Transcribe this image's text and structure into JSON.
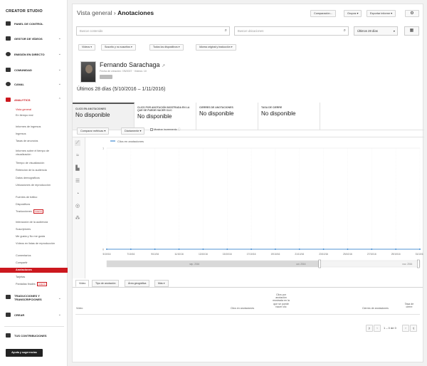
{
  "sidebar": {
    "title": "CREATOR STUDIO",
    "sections": {
      "panel": "PANEL DE CONTROL",
      "videos": "GESTOR DE VÍDEOS",
      "live": "EMISIÓN EN DIRECTO",
      "community": "COMUNIDAD",
      "channel": "CANAL",
      "analytics": "ANALYTICS",
      "translations": "TRADUCCIONES Y TRANSCRIPCIONES",
      "create": "CREAR",
      "contributions": "TUS CONTRIBUCIONES"
    },
    "items": {
      "overview": "Vista general",
      "realtime": "En tiempo real",
      "revenue_reports": "Informes de ingresos",
      "revenue": "Ingresos",
      "ad_rates": "Tasas de anuncios",
      "watch_time_reports": "Informes sobre el tiempo de visualización",
      "watch_time": "Tiempo de visualización",
      "retention": "Retención de la audiencia",
      "demographics": "Datos demográficos",
      "playback_locations": "Ubicaciones de reproducción",
      "traffic_sources": "Fuentes de tráfico",
      "devices": "Dispositivos",
      "translations_item": "Traducciones",
      "engagement_reports": "Interacción de la audiencia",
      "subscribers": "Suscriptores",
      "likes": "Me gusta y No me gusta",
      "playlists": "Vídeos en listas de reproducción",
      "comments": "Comentarios",
      "shares": "Compartir",
      "annotations": "Anotaciones",
      "cards": "Tarjetas",
      "end_screens": "Pantallas finales"
    },
    "badge_new": "NUEVO",
    "help_button": "Ayuda y sugerencias"
  },
  "header": {
    "breadcrumb_parent": "Vista general",
    "separator": "›",
    "title": "Anotaciones",
    "compare_button": "Comparación...",
    "groups_button": "Grupos",
    "export_button": "Exportar informe",
    "settings_icon": "gear-icon"
  },
  "filters": {
    "content_placeholder": "Buscar contenido",
    "location_placeholder": "Buscar ubicaciones",
    "period": "Últimos 28 días",
    "calendar_icon": "calendar-icon",
    "pills": [
      "Vídeos",
      "Suscrito y no suscritos",
      "Todos los dispositivos",
      "Idioma original y traducción"
    ]
  },
  "channel": {
    "name": "Fernando Sarachaga",
    "created": "Fecha de creación: 7/8/2007 · Vídeos: 10",
    "badge": "",
    "date_range": "Últimos 28 días (5/10/2016 – 1/11/2016)"
  },
  "metrics": [
    {
      "label": "CLICS EN ANOTACIONES",
      "value": "No disponible"
    },
    {
      "label": "CLICS POR ANOTACIÓN MOSTRADA EN LA QUE SE PUEDE HACER CLIC",
      "value": "No disponible"
    },
    {
      "label": "CIERRES DE ANOTACIONES",
      "value": "No disponible"
    },
    {
      "label": "TASA DE CIERRE",
      "value": "No disponible"
    }
  ],
  "chart_controls": {
    "compare_metrics": "Comparar métricas",
    "granularity": "Diariamente",
    "cumulative_label": "Mostrar incremento"
  },
  "chart_data": {
    "type": "line",
    "x": [
      "5/10/16",
      "7/10/16",
      "9/10/16",
      "11/10/16",
      "13/10/16",
      "15/10/16",
      "17/10/16",
      "19/10/16",
      "21/10/16",
      "23/10/16",
      "25/10/16",
      "27/10/16",
      "29/10/16",
      "31/10/16"
    ],
    "series": [
      {
        "name": "Clics en anotaciones",
        "values": [
          0,
          0,
          0,
          0,
          0,
          0,
          0,
          0,
          0,
          0,
          0,
          0,
          0,
          0
        ]
      }
    ],
    "ylim": [
      0,
      1
    ],
    "yticks": [
      "0",
      "1"
    ],
    "navigator": [
      "sep. 2016",
      "oct. 2016",
      "nov. 2016"
    ],
    "grid": true
  },
  "tabs": [
    "Vídeo",
    "Tipo de anotación",
    "Área geográfica",
    "Más"
  ],
  "table": {
    "columns": [
      "Vídeo",
      "Clics en anotaciones",
      "Clics por anotación mostrada en la que se puede hacer clic",
      "Cierres de anotaciones",
      "Tasa de cierre"
    ],
    "pagination": "1 – 0 de 0"
  },
  "colors": {
    "accent": "#cc181e",
    "series": "#1a73c8"
  }
}
